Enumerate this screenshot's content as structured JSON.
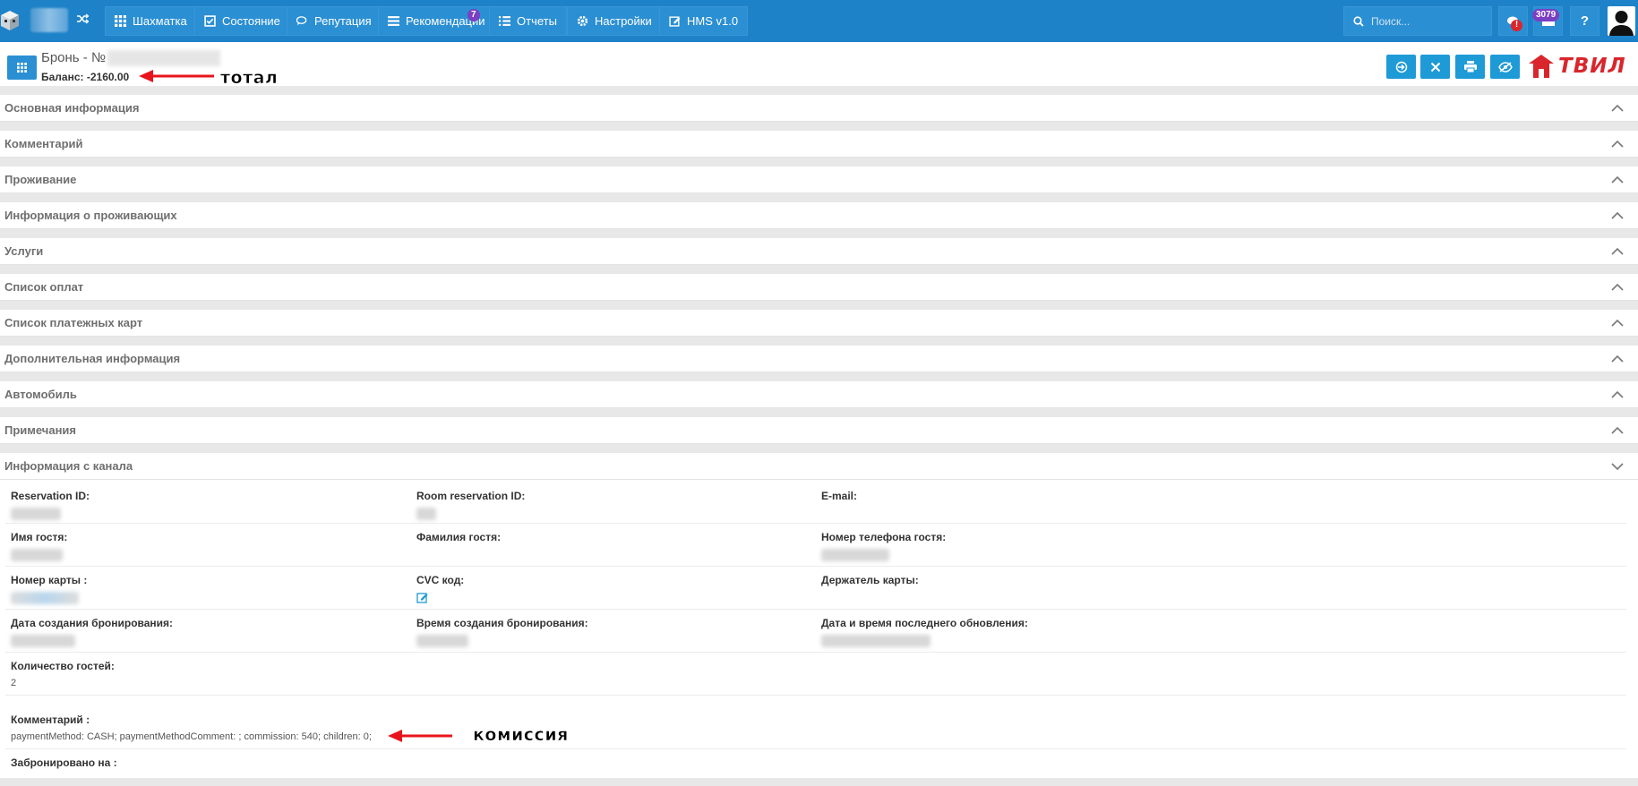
{
  "nav": {
    "items": [
      {
        "label": "Шахматка",
        "icon": "grid-icon"
      },
      {
        "label": "Состояние",
        "icon": "checkbox-icon"
      },
      {
        "label": "Репутация",
        "icon": "comments-icon"
      },
      {
        "label": "Рекомендации",
        "icon": "list-icon",
        "badge": "7"
      },
      {
        "label": "Отчеты",
        "icon": "list-ul-icon"
      },
      {
        "label": "Настройки",
        "icon": "gear-icon"
      },
      {
        "label": "HMS v1.0",
        "icon": "edit-icon"
      }
    ],
    "search_placeholder": "Поиск...",
    "notifications_badge": "!",
    "messages_badge": "3079",
    "help_label": "?"
  },
  "header": {
    "title": "Бронь - №",
    "balance": "Баланс: -2160.00",
    "annotation_total": "тотал",
    "brand": "ТВИЛ"
  },
  "sections": [
    "Основная информация",
    "Комментарий",
    "Проживание",
    "Информация о проживающих",
    "Услуги",
    "Список оплат",
    "Список платежных карт",
    "Дополнительная информация",
    "Автомобиль",
    "Примечания",
    "Информация с канала"
  ],
  "channel": {
    "reservation_id": "Reservation ID:",
    "room_reservation_id": "Room reservation ID:",
    "email": "E-mail:",
    "first_name": "Имя гостя:",
    "last_name": "Фамилия гостя:",
    "phone": "Номер телефона гостя:",
    "card_number": "Номер карты :",
    "cvc": "CVC код:",
    "card_holder": "Держатель карты:",
    "created_date": "Дата создания бронирования:",
    "created_time": "Время создания бронирования:",
    "updated": "Дата и время последнего обновления:",
    "guests_label": "Количество гостей:",
    "guests_value": "2",
    "comment_label": "Комментарий :",
    "comment_value": "paymentMethod: CASH; paymentMethodComment: ; commission: 540; children: 0;",
    "annotation_commission": "комиссия",
    "booked_on": "Забронировано на :"
  },
  "colors": {
    "navbar": "#1e82c8",
    "button": "#2b8fd3",
    "action": "#1e9ad6",
    "brand": "#d8262c",
    "annotation_arrow": "#e8141c"
  }
}
